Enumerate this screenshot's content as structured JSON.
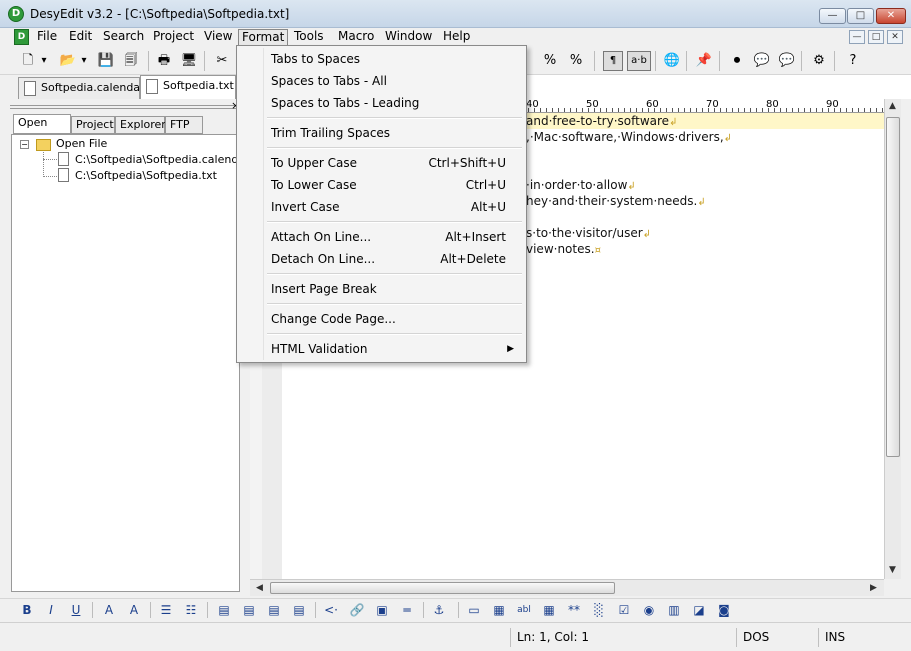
{
  "window": {
    "title": "DesyEdit v3.2 - [C:\\Softpedia\\Softpedia.txt]",
    "app_icon_glyph": "D",
    "controls": {
      "minimize": "—",
      "maximize": "□",
      "close": "✕"
    }
  },
  "menubar": {
    "items": [
      "File",
      "Edit",
      "Search",
      "Project",
      "View",
      "Format",
      "Tools",
      "Macro",
      "Window",
      "Help"
    ],
    "active": "Format"
  },
  "toolbar": {
    "buttons": [
      {
        "name": "new-file-icon",
        "glyph": "🗋"
      },
      {
        "name": "new-dropdown-icon",
        "glyph": "▾"
      },
      {
        "name": "open-folder-icon",
        "glyph": "📂"
      },
      {
        "name": "open-dropdown-icon",
        "glyph": "▾"
      },
      {
        "name": "save-icon",
        "glyph": "💾"
      },
      {
        "name": "save-all-icon",
        "glyph": "🗐"
      },
      {
        "name": "print-icon",
        "glyph": "🖶"
      },
      {
        "name": "print-preview-icon",
        "glyph": "🖥"
      },
      {
        "name": "cut-icon",
        "glyph": "✂"
      }
    ],
    "right_buttons": [
      {
        "name": "match-icon",
        "glyph": "%"
      },
      {
        "name": "match-off-icon",
        "glyph": "%"
      },
      {
        "name": "show-whitespace-icon",
        "glyph": "¶"
      },
      {
        "name": "word-wrap-icon",
        "glyph": "a·b"
      },
      {
        "name": "globe-icon",
        "glyph": "🌐"
      },
      {
        "name": "pin-icon",
        "glyph": "📌"
      },
      {
        "name": "record-icon",
        "glyph": "⏺"
      },
      {
        "name": "comment-icon",
        "glyph": "💬"
      },
      {
        "name": "comment-2-icon",
        "glyph": "💬"
      },
      {
        "name": "options-icon",
        "glyph": "⚙"
      },
      {
        "name": "help-icon",
        "glyph": "?"
      }
    ]
  },
  "doc_tabs": [
    {
      "label": "Softpedia.calendar",
      "active": false
    },
    {
      "label": "Softpedia.txt",
      "active": true
    }
  ],
  "left_panel": {
    "close_glyph": "×",
    "tabs": [
      "Open File",
      "Project",
      "Explorer",
      "FTP"
    ],
    "active_tab": "Open File",
    "tree": {
      "root": "Open File",
      "children": [
        "C:\\Softpedia\\Softpedia.calendar",
        "C:\\Softpedia\\Softpedia.txt"
      ]
    }
  },
  "ruler": {
    "labels": [
      "40",
      "50",
      "60",
      "70",
      "80",
      "90"
    ]
  },
  "editor": {
    "lines": [
      {
        "text": "and·free-to-try·software",
        "highlight": true
      },
      {
        "text": ",·Mac·software,·Windows·drivers,",
        "highlight": false
      },
      {
        "text": "",
        "highlight": false
      },
      {
        "text": "",
        "highlight": false
      },
      {
        "text": "·in·order·to·allow",
        "highlight": false
      },
      {
        "text": "hey·and·their·system·needs.",
        "highlight": false
      },
      {
        "text": "",
        "highlight": false
      },
      {
        "text": "s·to·the·visitor/user",
        "highlight": false
      },
      {
        "text": "view·notes.",
        "highlight": false
      }
    ],
    "line_end_glyph": "↲",
    "eof_glyph": "¤"
  },
  "format_menu": {
    "items": [
      {
        "label": "Tabs to Spaces",
        "shortcut": ""
      },
      {
        "label": "Spaces to Tabs - All",
        "shortcut": ""
      },
      {
        "label": "Spaces to Tabs - Leading",
        "shortcut": ""
      },
      {
        "sep": true
      },
      {
        "label": "Trim Trailing Spaces",
        "shortcut": ""
      },
      {
        "sep": true
      },
      {
        "label": "To Upper Case",
        "shortcut": "Ctrl+Shift+U"
      },
      {
        "label": "To Lower Case",
        "shortcut": "Ctrl+U"
      },
      {
        "label": "Invert Case",
        "shortcut": "Alt+U"
      },
      {
        "sep": true
      },
      {
        "label": "Attach On Line...",
        "shortcut": "Alt+Insert"
      },
      {
        "label": "Detach On Line...",
        "shortcut": "Alt+Delete"
      },
      {
        "sep": true
      },
      {
        "label": "Insert Page Break",
        "shortcut": ""
      },
      {
        "sep": true
      },
      {
        "label": "Change Code Page...",
        "shortcut": ""
      },
      {
        "sep": true
      },
      {
        "label": "HTML Validation",
        "shortcut": "",
        "submenu": true
      }
    ],
    "submenu_glyph": "▶"
  },
  "bottom_toolbar": {
    "buttons": [
      {
        "name": "bold-icon",
        "glyph": "B"
      },
      {
        "name": "italic-icon",
        "glyph": "I"
      },
      {
        "name": "underline-icon",
        "glyph": "U"
      },
      {
        "name": "font-icon",
        "glyph": "A"
      },
      {
        "name": "font-color-icon",
        "glyph": "A"
      },
      {
        "name": "bullet-list-icon",
        "glyph": "☰"
      },
      {
        "name": "numbered-list-icon",
        "glyph": "☷"
      },
      {
        "name": "align-left-icon",
        "glyph": "▤"
      },
      {
        "name": "align-center-icon",
        "glyph": "▤"
      },
      {
        "name": "align-right-icon",
        "glyph": "▤"
      },
      {
        "name": "justify-icon",
        "glyph": "▤"
      },
      {
        "name": "comment-tag-icon",
        "glyph": "<·"
      },
      {
        "name": "link-icon",
        "glyph": "🔗"
      },
      {
        "name": "image-icon",
        "glyph": "▣"
      },
      {
        "name": "horizontal-rule-icon",
        "glyph": "═"
      },
      {
        "name": "anchor-icon",
        "glyph": "⚓"
      },
      {
        "name": "form-icon",
        "glyph": "▭"
      },
      {
        "name": "frame-icon",
        "glyph": "▦"
      },
      {
        "name": "textfield-icon",
        "glyph": "abl"
      },
      {
        "name": "table-icon",
        "glyph": "▦"
      },
      {
        "name": "password-icon",
        "glyph": "**"
      },
      {
        "name": "hidden-field-icon",
        "glyph": "░"
      },
      {
        "name": "checkbox-icon",
        "glyph": "☑"
      },
      {
        "name": "radio-icon",
        "glyph": "◉"
      },
      {
        "name": "listbox-icon",
        "glyph": "▥"
      },
      {
        "name": "button-icon",
        "glyph": "◪"
      },
      {
        "name": "submit-icon",
        "glyph": "◙"
      }
    ]
  },
  "statusbar": {
    "position": "Ln: 1, Col: 1",
    "format": "DOS",
    "mode": "INS"
  }
}
